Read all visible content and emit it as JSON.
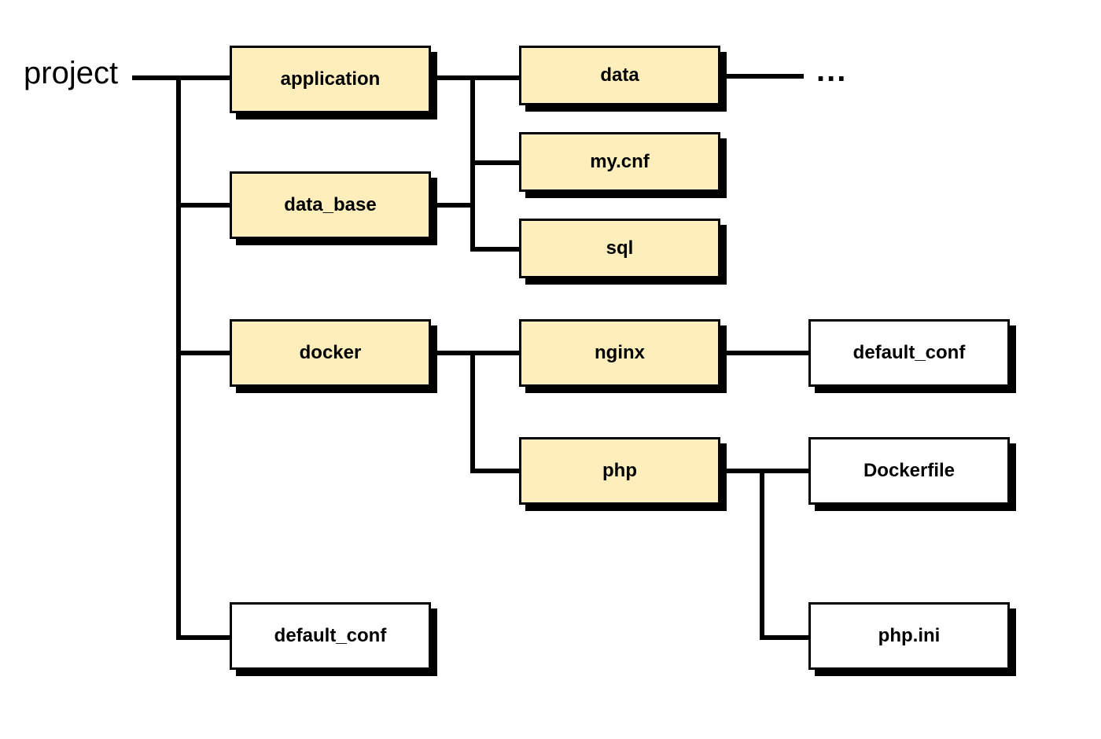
{
  "root": {
    "label": "project"
  },
  "ellipsis": "...",
  "nodes": {
    "application": {
      "label": "application"
    },
    "data_base": {
      "label": "data_base"
    },
    "docker": {
      "label": "docker"
    },
    "default_conf_root": {
      "label": "default_conf"
    },
    "data": {
      "label": "data"
    },
    "mycnf": {
      "label": "my.cnf"
    },
    "sql": {
      "label": "sql"
    },
    "nginx": {
      "label": "nginx"
    },
    "php": {
      "label": "php"
    },
    "default_conf_nginx": {
      "label": "default_conf"
    },
    "dockerfile": {
      "label": "Dockerfile"
    },
    "phpini": {
      "label": "php.ini"
    }
  }
}
